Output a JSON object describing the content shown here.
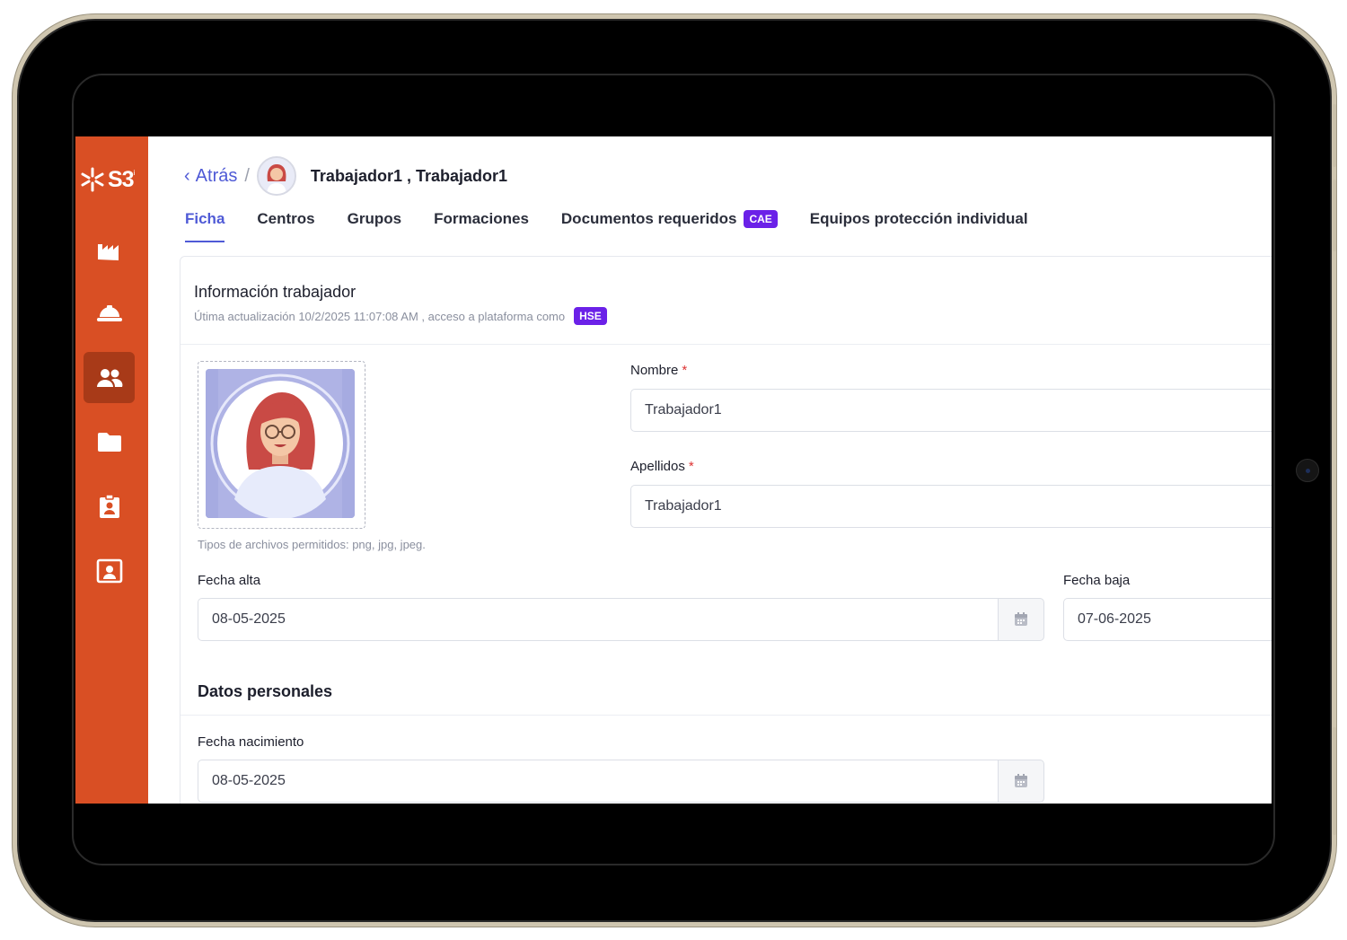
{
  "header": {
    "back_label": "Atrás",
    "separator": "/",
    "title": "Trabajador1 , Trabajador1"
  },
  "tabs": [
    {
      "label": "Ficha"
    },
    {
      "label": "Centros"
    },
    {
      "label": "Grupos"
    },
    {
      "label": "Formaciones"
    },
    {
      "label": "Documentos requeridos",
      "badge": "CAE"
    },
    {
      "label": "Equipos protección individual"
    }
  ],
  "sidebar": {
    "logo": "S3",
    "items": [
      {
        "icon": "factory-icon"
      },
      {
        "icon": "hardhat-icon"
      },
      {
        "icon": "users-icon",
        "active": true
      },
      {
        "icon": "folder-icon"
      },
      {
        "icon": "clipboard-user-icon"
      },
      {
        "icon": "user-screen-icon"
      }
    ]
  },
  "card": {
    "title": "Información trabajador",
    "subtitle": "Útima actualización 10/2/2025 11:07:08 AM , acceso a plataforma como",
    "role_badge": "HSE",
    "file_hint": "Tipos de archivos permitidos: png, jpg, jpeg."
  },
  "form": {
    "nombre_label": "Nombre",
    "nombre_value": "Trabajador1",
    "apellidos_label": "Apellidos",
    "apellidos_value": "Trabajador1",
    "fecha_alta_label": "Fecha alta",
    "fecha_alta_value": "08-05-2025",
    "fecha_baja_label": "Fecha baja",
    "fecha_baja_value": "07-06-2025",
    "datos_personales": "Datos personales",
    "fecha_nacimiento_label": "Fecha nacimiento",
    "fecha_nacimiento_value": "08-05-2025",
    "required_mark": "*"
  },
  "colors": {
    "brand": "#d94f24",
    "accent": "#4f5ad6",
    "badge": "#6b21e8"
  }
}
